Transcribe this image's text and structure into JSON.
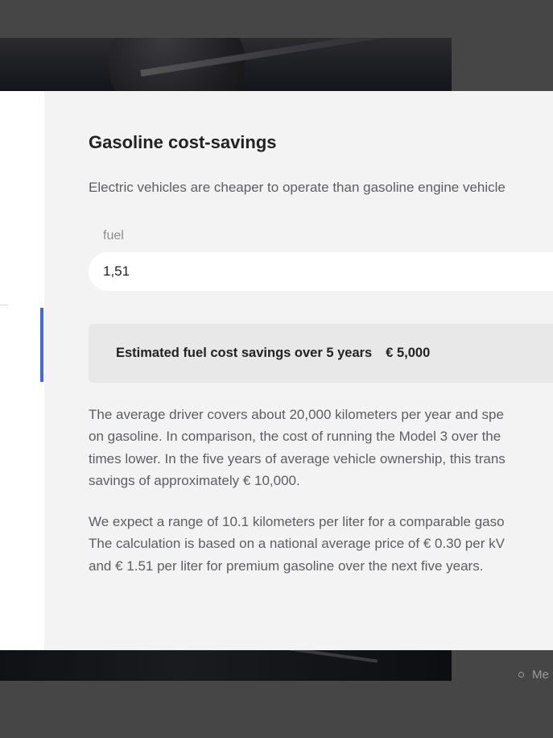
{
  "hero_detail_glyph": "⌄⌄",
  "footnote": {
    "text": "Me"
  },
  "panel": {
    "title": "Gasoline cost-savings",
    "intro": "Electric vehicles are cheaper to operate than gasoline engine vehicle",
    "fuel_field": {
      "label": "fuel",
      "value": "1,51"
    },
    "estimate": {
      "label": "Estimated fuel cost savings over 5 years",
      "value": "€ 5,000"
    },
    "paragraph1": [
      "The average driver covers about 20,000 kilometers per year and spe",
      "on gasoline. In comparison, the cost of running the Model 3 over the",
      "times lower. In the five years of average vehicle ownership, this trans",
      "savings of approximately € 10,000."
    ],
    "paragraph2": [
      "We expect a range of 10.1 kilometers per liter for a comparable gaso",
      "The calculation is based on a national average price of € 0.30 per kV",
      "and € 1.51 per liter for premium gasoline over the next five years."
    ]
  },
  "colors": {
    "overlay": "#464646",
    "panel_bg": "#f3f3f3",
    "sidebar_bg": "#ffffff",
    "accent": "#3e6ae1",
    "estimate_bg": "#e8e8e8",
    "heading_text": "#222222",
    "body_text": "#5c5e62"
  }
}
